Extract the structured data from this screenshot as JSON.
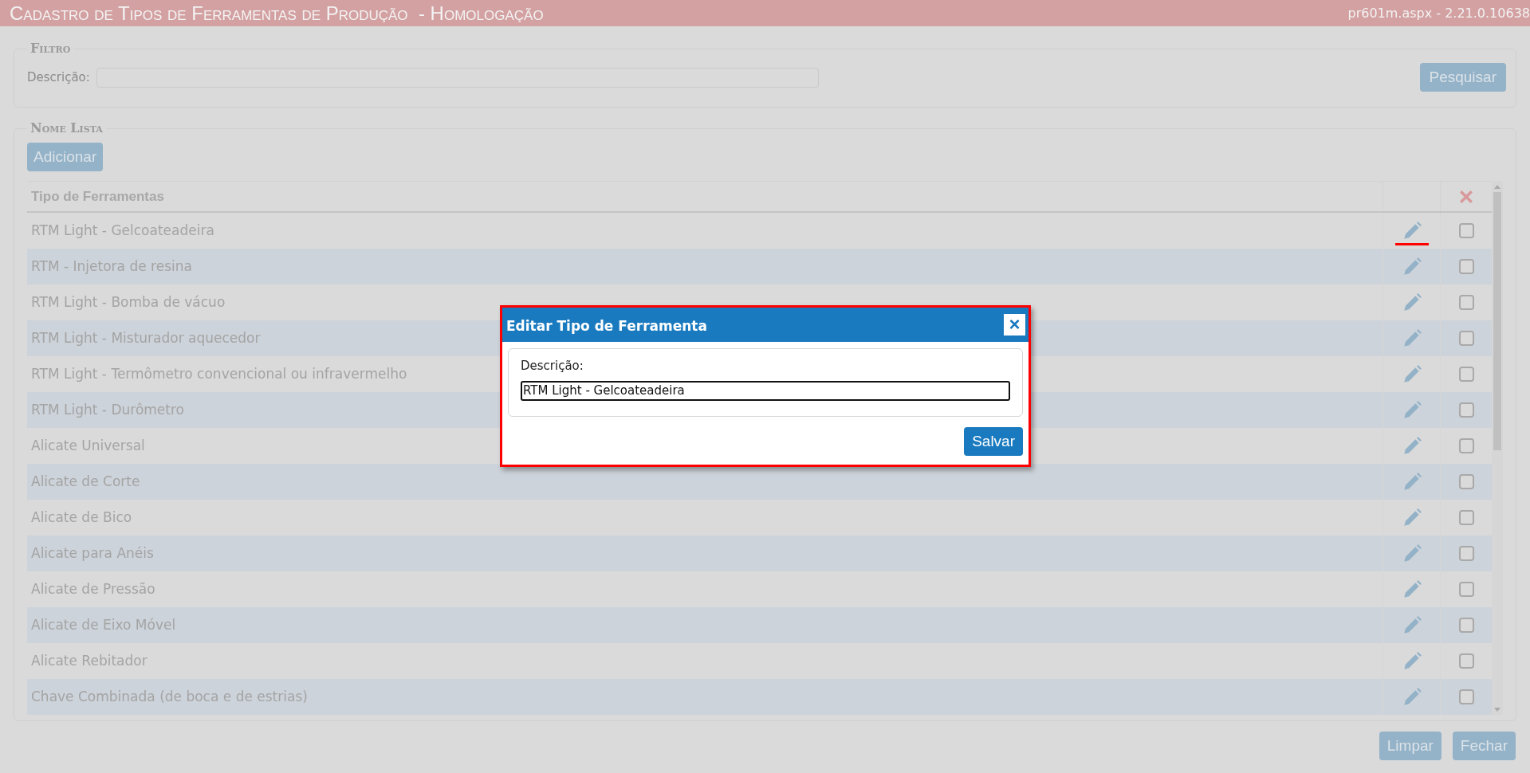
{
  "header": {
    "title": "Cadastro de Tipos de Ferramentas de Produção  - Homologação",
    "version": "pr601m.aspx - 2.21.0.10638"
  },
  "filter": {
    "legend": "Filtro",
    "label": "Descrição:",
    "search_button": "Pesquisar"
  },
  "list": {
    "legend": "Nome Lista",
    "add_button": "Adicionar",
    "column": "Tipo de Ferramentas",
    "rows": [
      {
        "name": "RTM Light - Gelcoateadeira",
        "checked": false,
        "marked": true
      },
      {
        "name": "RTM - Injetora de resina",
        "checked": false,
        "marked": false
      },
      {
        "name": "RTM Light - Bomba de vácuo",
        "checked": false,
        "marked": false
      },
      {
        "name": "RTM Light - Misturador aquecedor",
        "checked": false,
        "marked": false
      },
      {
        "name": "RTM Light - Termômetro convencional ou infravermelho",
        "checked": false,
        "marked": false
      },
      {
        "name": "RTM Light - Durômetro",
        "checked": false,
        "marked": false
      },
      {
        "name": "Alicate Universal",
        "checked": false,
        "marked": false
      },
      {
        "name": "Alicate de Corte",
        "checked": false,
        "marked": false
      },
      {
        "name": "Alicate de Bico",
        "checked": false,
        "marked": false
      },
      {
        "name": "Alicate para Anéis",
        "checked": false,
        "marked": false
      },
      {
        "name": "Alicate de Pressão",
        "checked": false,
        "marked": false
      },
      {
        "name": "Alicate de Eixo Móvel",
        "checked": false,
        "marked": false
      },
      {
        "name": "Alicate Rebitador",
        "checked": false,
        "marked": false
      },
      {
        "name": "Chave Combinada (de boca e de estrias)",
        "checked": false,
        "marked": false
      }
    ]
  },
  "dialog": {
    "title": "Editar Tipo de Ferramenta",
    "close": "×",
    "label": "Descrição:",
    "value": "RTM Light - Gelcoateadeira",
    "save_button": "Salvar"
  },
  "footer_buttons": [
    "Limpar",
    "Fechar"
  ]
}
